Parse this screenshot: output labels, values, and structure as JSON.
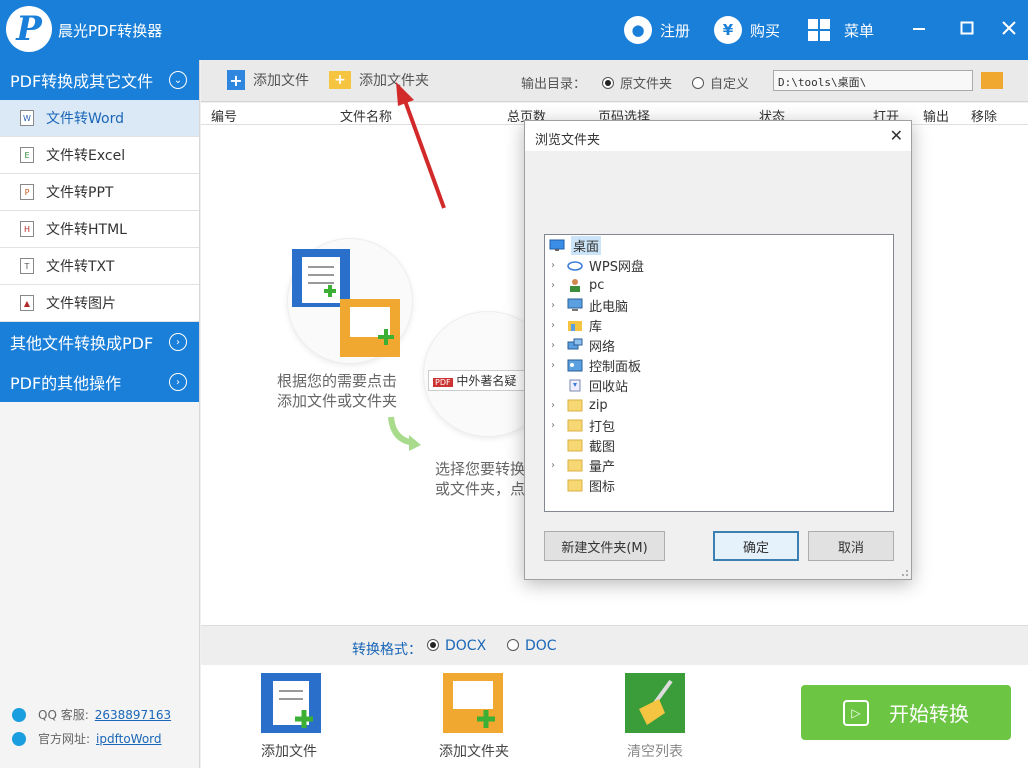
{
  "app": {
    "title": "晨光PDF转换器"
  },
  "titlebar": {
    "register": "注册",
    "buy": "购买",
    "menu": "菜单"
  },
  "sidebar": {
    "section1": "PDF转换成其它文件",
    "items": [
      {
        "label": "文件转Word",
        "icon": "W"
      },
      {
        "label": "文件转Excel",
        "icon": "E"
      },
      {
        "label": "文件转PPT",
        "icon": "P"
      },
      {
        "label": "文件转HTML",
        "icon": "H"
      },
      {
        "label": "文件转TXT",
        "icon": "T"
      },
      {
        "label": "文件转图片",
        "icon": "▲"
      }
    ],
    "section2": "其他文件转换成PDF",
    "section3": "PDF的其他操作",
    "qq_label": "QQ 客服:",
    "qq_value": "2638897163",
    "site_label": "官方网址:",
    "site_value": "ipdftoWord"
  },
  "toolbar": {
    "add_file": "添加文件",
    "add_folder": "添加文件夹",
    "output_label": "输出目录：",
    "opt_source": "原文件夹",
    "opt_custom": "自定义",
    "path": "D:\\tools\\桌面\\"
  },
  "table": {
    "headers": [
      "编号",
      "文件名称",
      "总页数",
      "页码选择",
      "状态",
      "打开",
      "输出",
      "移除"
    ]
  },
  "main": {
    "hint1_line1": "根据您的需要点击",
    "hint1_line2": "添加文件或文件夹",
    "hint2_line1": "选择您要转换",
    "hint2_line2": "或文件夹，点",
    "illus_text": "中外著名疑"
  },
  "format": {
    "label": "转换格式：",
    "docx": "DOCX",
    "doc": "DOC"
  },
  "bottom": {
    "add_file": "添加文件",
    "add_folder": "添加文件夹",
    "clear": "清空列表",
    "start": "开始转换"
  },
  "dialog": {
    "title": "浏览文件夹",
    "tree": [
      {
        "label": "桌面",
        "icon": "desktop",
        "expand": false,
        "root": true
      },
      {
        "label": "WPS网盘",
        "icon": "cloud",
        "expand": true
      },
      {
        "label": "pc",
        "icon": "user",
        "expand": true
      },
      {
        "label": "此电脑",
        "icon": "computer",
        "expand": true
      },
      {
        "label": "库",
        "icon": "library",
        "expand": true
      },
      {
        "label": "网络",
        "icon": "network",
        "expand": true
      },
      {
        "label": "控制面板",
        "icon": "control-panel",
        "expand": true
      },
      {
        "label": "回收站",
        "icon": "recycle",
        "expand": false
      },
      {
        "label": "zip",
        "icon": "folder",
        "expand": true
      },
      {
        "label": "打包",
        "icon": "folder",
        "expand": true
      },
      {
        "label": "截图",
        "icon": "folder",
        "expand": false
      },
      {
        "label": "量产",
        "icon": "folder",
        "expand": true
      },
      {
        "label": "图标",
        "icon": "folder",
        "expand": false
      }
    ],
    "new_folder": "新建文件夹(M)",
    "ok": "确定",
    "cancel": "取消"
  },
  "colors": {
    "brand": "#1a7fd8",
    "start": "#6cc644",
    "annotation": "#d22a2a"
  }
}
